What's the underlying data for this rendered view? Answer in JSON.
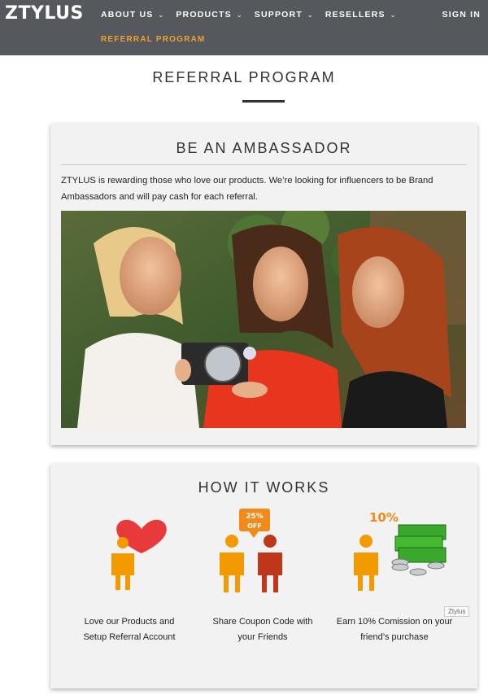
{
  "header": {
    "logo": "ZTYLUS",
    "nav": [
      {
        "label": "ABOUT US",
        "chevron": "⌄"
      },
      {
        "label": "PRODUCTS",
        "chevron": "⌄"
      },
      {
        "label": "SUPPORT",
        "chevron": "⌄"
      },
      {
        "label": "RESELLERS",
        "chevron": "⌄"
      }
    ],
    "active_subnav": "REFERRAL PROGRAM",
    "signin": "SIGN IN",
    "colors": {
      "bar": "#55585c",
      "active": "#f0a030"
    }
  },
  "page": {
    "title": "REFERRAL PROGRAM"
  },
  "ambassador": {
    "title": "BE AN AMBASSADOR",
    "text": "ZTYLUS is rewarding those who love our products. We’re looking for influencers to be Brand Ambassadors and will pay cash for each referral.",
    "image": "three-women-taking-selfie-photo"
  },
  "how": {
    "title": "HOW IT WORKS",
    "steps": [
      {
        "line1": "Love our Products and",
        "line2": "Setup Referral Account",
        "icon": "heart-person-icon"
      },
      {
        "line1": "Share Coupon Code with",
        "line2": "your Friends",
        "icon": "coupon-share-icon",
        "badge_top": "25%",
        "badge_bottom": "OFF"
      },
      {
        "line1": "Earn 10% Comission on your",
        "line2": "friend’s purchase",
        "icon": "cash-commission-icon",
        "percent": "10%"
      }
    ],
    "tag": "Ztylus"
  }
}
